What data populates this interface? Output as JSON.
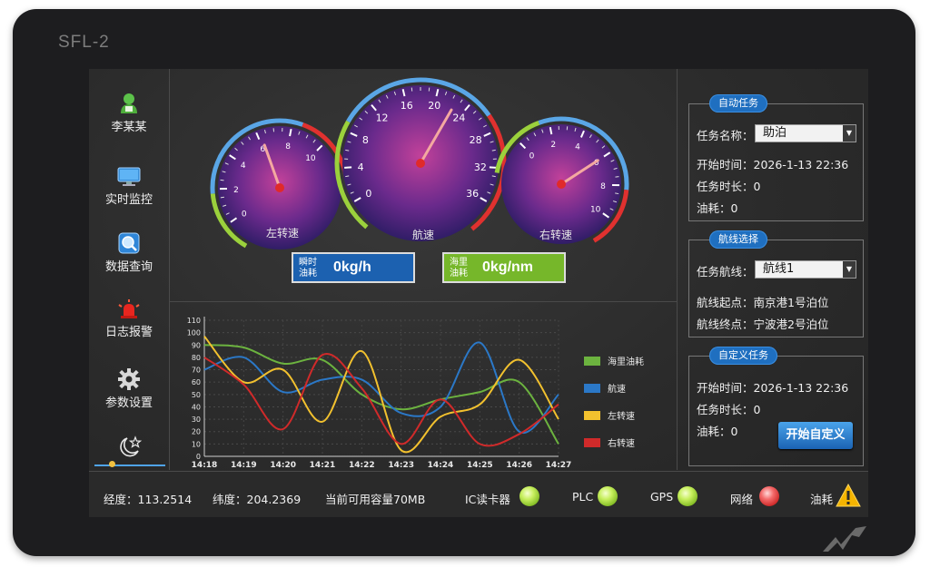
{
  "device": {
    "model": "SFL-2"
  },
  "sidebar": {
    "items": [
      {
        "label": "李某某",
        "icon": "user-icon"
      },
      {
        "label": "实时监控",
        "icon": "monitor-icon"
      },
      {
        "label": "数据查询",
        "icon": "search-icon"
      },
      {
        "label": "日志报警",
        "icon": "alarm-icon"
      },
      {
        "label": "参数设置",
        "icon": "gear-icon"
      }
    ],
    "theme_icon": "moon-star-icon"
  },
  "gauges": {
    "left": {
      "label": "左转速",
      "ticks": [
        "0",
        "2",
        "4",
        "6",
        "8",
        "10"
      ],
      "min": 0,
      "max": 10,
      "value": 6.2
    },
    "center": {
      "label": "航速",
      "ticks": [
        "0",
        "4",
        "8",
        "12",
        "16",
        "20",
        "24",
        "28",
        "32",
        "36"
      ],
      "min": 0,
      "max": 36,
      "value": 22.5
    },
    "right": {
      "label": "右转速",
      "ticks": [
        "0",
        "2",
        "4",
        "6",
        "8",
        "10"
      ],
      "min": 0,
      "max": 10,
      "value": 6.0
    }
  },
  "fuel": {
    "instant_label_1": "瞬时",
    "instant_label_2": "油耗",
    "instant_value": "0kg/h",
    "nm_label_1": "海里",
    "nm_label_2": "油耗",
    "nm_value": "0kg/nm",
    "colors": {
      "instant": "#1c61b0",
      "nm": "#76b72a"
    }
  },
  "chart_data": {
    "type": "line",
    "x": [
      "14:18",
      "14:19",
      "14:20",
      "14:21",
      "14:22",
      "14:23",
      "14:24",
      "14:25",
      "14:26",
      "14:27"
    ],
    "yticks": [
      "0",
      "10",
      "20",
      "30",
      "40",
      "50",
      "60",
      "70",
      "80",
      "90",
      "100",
      "110"
    ],
    "ylim": [
      0,
      110
    ],
    "legend_position": "right",
    "series": [
      {
        "name": "海里油耗",
        "color": "#6cb33f",
        "values": [
          90,
          88,
          75,
          78,
          50,
          38,
          46,
          52,
          60,
          10
        ]
      },
      {
        "name": "航速",
        "color": "#2b78c7",
        "values": [
          70,
          80,
          52,
          62,
          62,
          35,
          40,
          92,
          20,
          50
        ]
      },
      {
        "name": "左转速",
        "color": "#f2c12e",
        "values": [
          97,
          60,
          70,
          28,
          85,
          5,
          32,
          42,
          78,
          30
        ]
      },
      {
        "name": "右转速",
        "color": "#d02a2a",
        "values": [
          80,
          58,
          22,
          82,
          55,
          10,
          46,
          10,
          18,
          42
        ]
      }
    ]
  },
  "tasks": {
    "auto": {
      "title": "自动任务",
      "name_label": "任务名称：",
      "name_value": "助泊",
      "start_text": "开始时间：2026-1-13  22:36",
      "duration_text": "任务时长：0",
      "fuel_text": "油耗：0"
    },
    "route": {
      "title": "航线选择",
      "route_label": "任务航线：",
      "route_value": "航线1",
      "start_text": "航线起点：南京港1号泊位",
      "end_text": "航线终点：宁波港2号泊位"
    },
    "custom": {
      "title": "自定义任务",
      "start_text": "开始时间：2026-1-13  22:36",
      "duration_text": "任务时长：0",
      "fuel_text": "油耗：0",
      "start_button": "开始自定义"
    }
  },
  "status": {
    "longitude": "经度：113.2514",
    "latitude": "纬度：204.2369",
    "capacity": "当前可用容量70MB",
    "ic_label": "IC读卡器",
    "plc_label": "PLC",
    "gps_label": "GPS",
    "net_label": "网络",
    "fuel_label": "油耗",
    "colors": {
      "ok": "#a6dc3c",
      "error": "#e03a3a",
      "warn": "#f5b400"
    }
  }
}
